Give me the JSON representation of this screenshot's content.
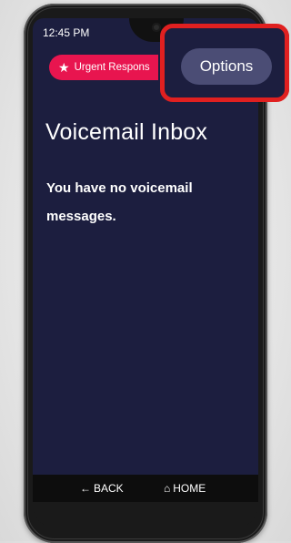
{
  "status_bar": {
    "time": "12:45 PM"
  },
  "urgent_button": {
    "icon": "star-icon",
    "label": "Urgent Respons"
  },
  "options_button": {
    "label": "Options"
  },
  "page": {
    "title": "Voicemail Inbox",
    "message": "You have no voicemail messages."
  },
  "nav": {
    "back_icon": "arrow-left-icon",
    "back_label": "BACK",
    "home_icon": "home-icon",
    "home_label": "HOME"
  },
  "colors": {
    "screen_background": "#1c1e3f",
    "urgent_accent": "#e8154f",
    "options_button": "#4b4d75",
    "highlight_outline": "#e02020"
  }
}
